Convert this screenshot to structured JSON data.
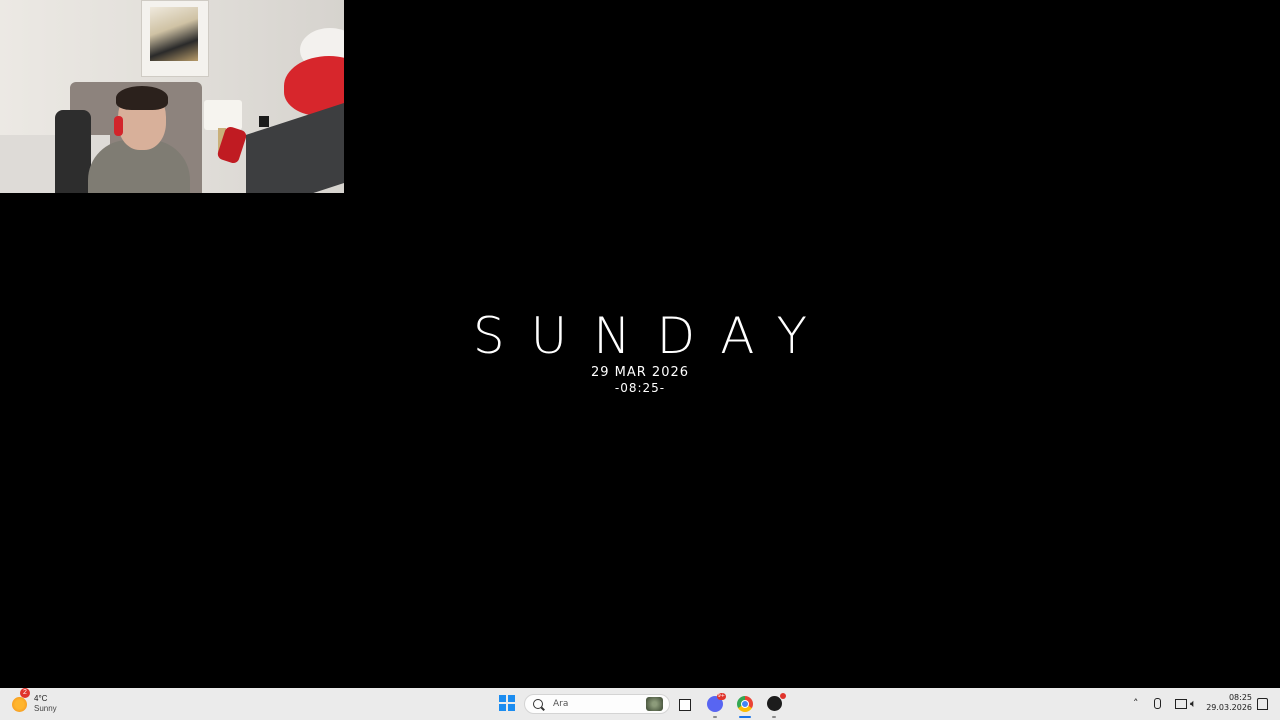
{
  "desktop": {
    "day": "SUNDAY",
    "date": "29 MAR 2026",
    "time": "-08:25-"
  },
  "taskbar": {
    "weather": {
      "temp": "4°C",
      "condition": "Sunny",
      "badge": "2",
      "icon": "sun-icon"
    },
    "search": {
      "placeholder": "Ara"
    },
    "apps": [
      {
        "name": "task-view",
        "icon": "task-view-icon"
      },
      {
        "name": "discord",
        "icon": "discord-icon",
        "badge": "9+"
      },
      {
        "name": "chrome",
        "icon": "chrome-icon",
        "active": true
      },
      {
        "name": "obs",
        "icon": "obs-icon"
      }
    ],
    "tray": {
      "time": "08:25",
      "date": "29.03.2026"
    },
    "colors": {
      "taskbar_bg": "#ebebeb",
      "start_blue": "#1b8cf0",
      "badge_red": "#e0342c"
    }
  },
  "webcam": {
    "label": ""
  }
}
